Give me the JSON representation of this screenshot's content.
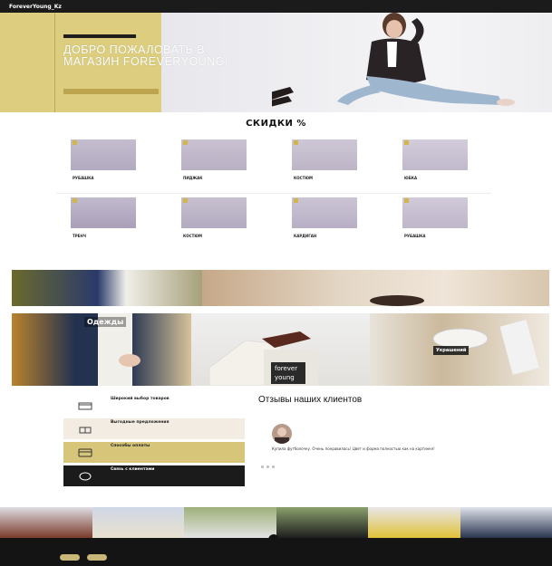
{
  "header": {
    "logo": "ForeverYoung_Kz",
    "nav": [
      "",
      "",
      "",
      "",
      "",
      ""
    ]
  },
  "hero": {
    "title": "ДОБРО ПОЖАЛОВАТЬ В МАГАЗИН FOREVERYOUNG!"
  },
  "sale": {
    "title": "СКИДКИ %"
  },
  "products": [
    {
      "name": "РУБАШКА"
    },
    {
      "name": "ПИДЖАК"
    },
    {
      "name": "КОСТЮМ"
    },
    {
      "name": "ЮБКА"
    },
    {
      "name": "ТРЕНЧ"
    },
    {
      "name": "КОСТЮМ"
    },
    {
      "name": "КАРДИГАН"
    },
    {
      "name": "РУБАШКА"
    }
  ],
  "collections": {
    "clothes_title": "Одежды",
    "jewelry_title": "Украшений",
    "bag_brand": "forever young"
  },
  "features": [
    {
      "title": "Широкий выбор товаров"
    },
    {
      "title": "Выгодные предложения"
    },
    {
      "title": "Способы оплаты"
    },
    {
      "title": "Связь с клиентами"
    }
  ],
  "reviews": {
    "title": "Отзывы наших клиентов",
    "text": "Купила футболочку. Очень понравилась! Цвет и форма полностью как на картинке!"
  },
  "colors": {
    "accent": "#d1b64d",
    "hero_bg": "#dccd7f",
    "dark": "#1b1b1b"
  }
}
